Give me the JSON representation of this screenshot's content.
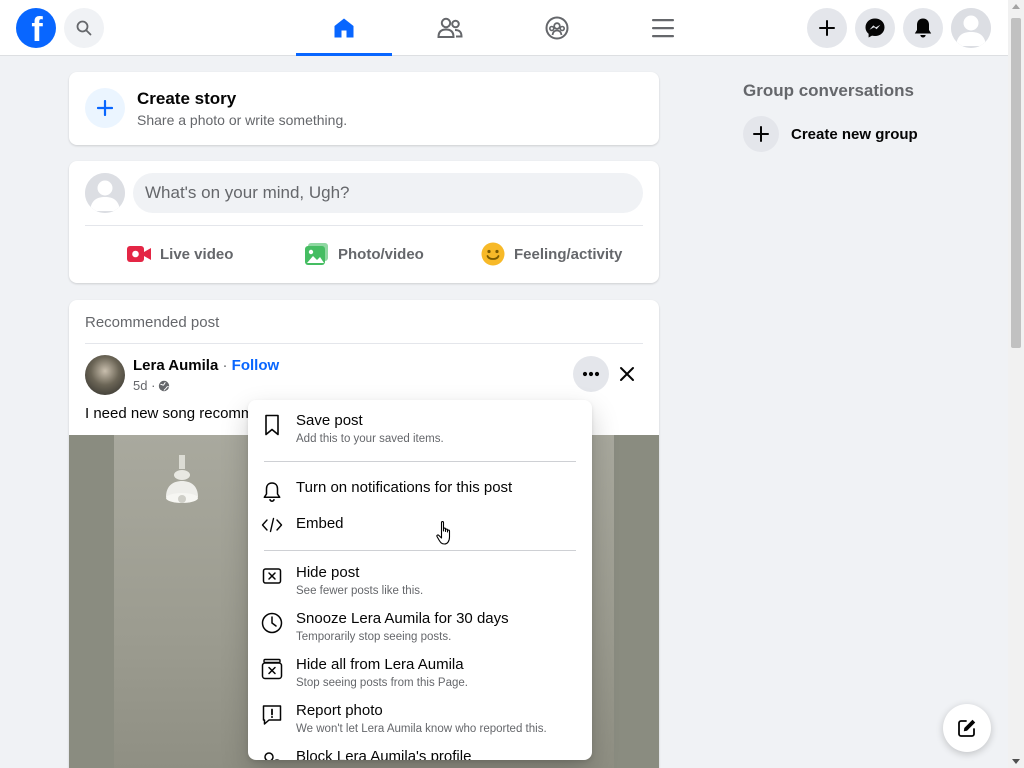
{
  "colors": {
    "brand": "#0866ff",
    "secondary_text": "#65676b",
    "page_bg": "#f0f2f5"
  },
  "topbar": {
    "logo_icon": "facebook-logo-icon",
    "search_icon": "search-icon",
    "nav": [
      {
        "name": "home",
        "icon": "home-icon",
        "active": true
      },
      {
        "name": "friends",
        "icon": "friends-icon",
        "active": false
      },
      {
        "name": "groups",
        "icon": "groups-icon",
        "active": false
      },
      {
        "name": "menu",
        "icon": "hamburger-icon",
        "active": false
      }
    ],
    "actions": [
      "create-icon",
      "messenger-icon",
      "notifications-icon"
    ],
    "profile_icon": "avatar"
  },
  "story": {
    "title": "Create story",
    "subtitle": "Share a photo or write something."
  },
  "composer": {
    "placeholder": "What's on your mind, Ugh?",
    "actions": [
      {
        "label": "Live video",
        "icon": "live-video-icon",
        "color": "#e42645"
      },
      {
        "label": "Photo/video",
        "icon": "photo-icon",
        "color": "#45bd62"
      },
      {
        "label": "Feeling/activity",
        "icon": "feeling-icon",
        "color": "#f7b928"
      }
    ]
  },
  "post": {
    "section_label": "Recommended post",
    "author": "Lera Aumila",
    "separator": "·",
    "follow_label": "Follow",
    "time": "5d ·",
    "text": "I need new song recomm"
  },
  "right_column": {
    "title": "Group conversations",
    "create_group_label": "Create new group"
  },
  "menu": {
    "items": [
      {
        "title": "Save post",
        "subtitle": "Add this to your saved items.",
        "icon": "bookmark-icon"
      },
      {
        "title": "Turn on notifications for this post",
        "subtitle": "",
        "icon": "bell-icon"
      },
      {
        "title": "Embed",
        "subtitle": "",
        "icon": "code-icon"
      },
      {
        "title": "Hide post",
        "subtitle": "See fewer posts like this.",
        "icon": "hide-icon"
      },
      {
        "title": "Snooze Lera Aumila for 30 days",
        "subtitle": "Temporarily stop seeing posts.",
        "icon": "clock-icon"
      },
      {
        "title": "Hide all from Lera Aumila",
        "subtitle": "Stop seeing posts from this Page.",
        "icon": "hide-all-icon"
      },
      {
        "title": "Report photo",
        "subtitle": "We won't let Lera Aumila know who reported this.",
        "icon": "report-icon"
      },
      {
        "title": "Block Lera Aumila's profile",
        "subtitle": "",
        "icon": "block-icon"
      }
    ]
  }
}
